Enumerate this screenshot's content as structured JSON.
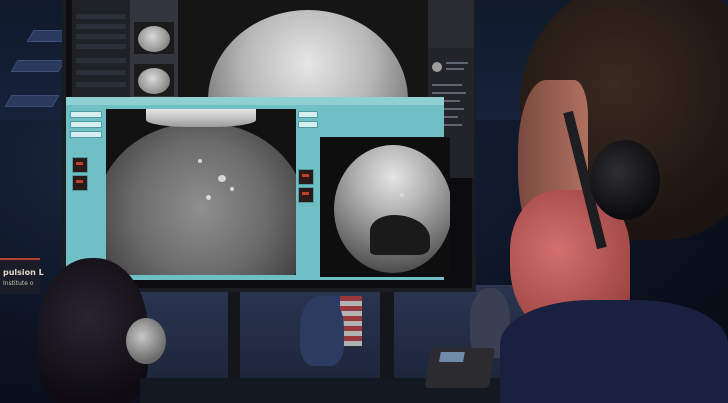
{
  "scene": {
    "description_tags": [
      "mission-control",
      "monitor",
      "mars-landing-images"
    ],
    "banner": {
      "line1": "pulsion L",
      "line2": "Institute o"
    }
  },
  "monitor": {
    "top_app": {
      "panel_title": "",
      "panel_rows": [
        "",
        "",
        "",
        "",
        "",
        "",
        ""
      ]
    },
    "lower_app": {
      "mini_labels": [
        "",
        "",
        "",
        ""
      ]
    },
    "statusbar": []
  },
  "colors": {
    "teal_ui": "#6fbfc4",
    "dark_ui": "#2a2b30",
    "mask": "#c0605e"
  }
}
